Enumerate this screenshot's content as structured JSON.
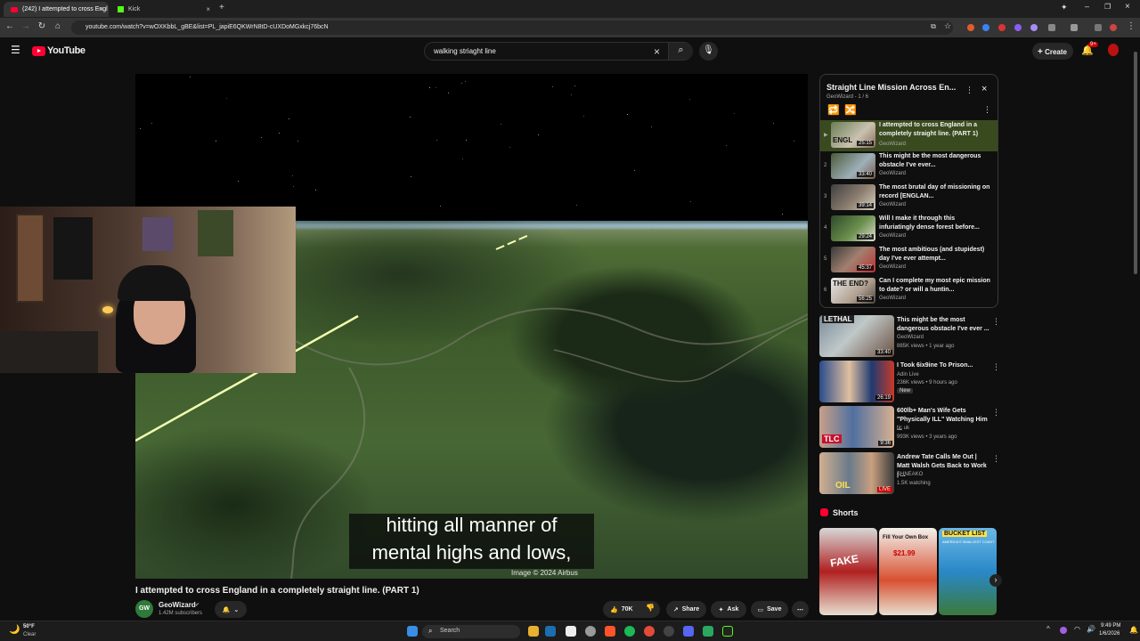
{
  "browser": {
    "tabs": [
      {
        "title": "(242) I attempted to cross Engl",
        "close": "×"
      },
      {
        "title": "Kick",
        "close": "×"
      }
    ],
    "new_tab": "+",
    "url": "youtube.com/watch?v=wOXKbbL_gBE&list=PL_japiE6QKWrN8tD-cUXDoMGxkcj76bcN"
  },
  "youtube": {
    "logo_text": "YouTube",
    "search_value": "walking striaght line",
    "create_label": "Create",
    "notif_badge": "9+"
  },
  "video": {
    "subtitle_line1": "hitting all manner of",
    "subtitle_line2": "mental highs and lows,",
    "credit": "Image © 2024 Airbus",
    "title": "I attempted to cross England in a completely straight line. (PART 1)",
    "channel": "GeoWizard",
    "channel_avatar": "GW",
    "subscribers": "1.42M subscribers",
    "likes": "70K",
    "share": "Share",
    "ask": "Ask",
    "save": "Save"
  },
  "playlist": {
    "title": "Straight Line Mission Across En...",
    "meta": "GeoWizard - 1 / 6",
    "items": [
      {
        "num": "▶",
        "title": "I attempted to cross England in a completely straight line. (PART 1)",
        "channel": "GeoWizard",
        "duration": "25:15",
        "thumb": "ENGL"
      },
      {
        "num": "2",
        "title": "This might be the most dangerous obstacle I've ever...",
        "channel": "GeoWizard",
        "duration": "33:40",
        "thumb": ""
      },
      {
        "num": "3",
        "title": "The most brutal day of missioning on record [ENGLAN...",
        "channel": "GeoWizard",
        "duration": "39:14",
        "thumb": ""
      },
      {
        "num": "4",
        "title": "Will I make it through this infuriatingly dense forest before...",
        "channel": "GeoWizard",
        "duration": "29:24",
        "thumb": ""
      },
      {
        "num": "5",
        "title": "The most ambitious (and stupidest) day I've ever attempt...",
        "channel": "GeoWizard",
        "duration": "45:37",
        "thumb": ""
      },
      {
        "num": "6",
        "title": "Can I complete my most epic mission to date? or will a huntin...",
        "channel": "GeoWizard",
        "duration": "56:25",
        "thumb": "THE END?"
      }
    ]
  },
  "recommendations": [
    {
      "title": "This might be the most dangerous obstacle I've ever ...",
      "channel": "GeoWizard",
      "meta": "885K views • 1 year ago",
      "duration": "33:40",
      "badge": "",
      "thumb_text": "LETHAL"
    },
    {
      "title": "I Took 6ix9ine To Prison...",
      "channel": "Adin Live",
      "meta": "236K views • 9 hours ago",
      "duration": "26:19",
      "badge": "New",
      "thumb_text": ""
    },
    {
      "title": "600lb+ Man's Wife Gets \"Physically ILL\" Watching Him ...",
      "channel": "tic uk",
      "meta": "993K views • 3 years ago",
      "duration": "9:36",
      "badge": "",
      "thumb_text": "TLC"
    },
    {
      "title": "Andrew Tate Calls Me Out | Matt Walsh Gets Back to Work | ...",
      "channel": "SHNEAKO",
      "meta": "1.5K watching",
      "duration": "LIVE",
      "badge": "",
      "thumb_text": "OIL"
    }
  ],
  "shorts": {
    "heading": "Shorts",
    "items": [
      {
        "text": "FAKE"
      },
      {
        "text": "Fill Your Own Box",
        "price": "$21.99"
      },
      {
        "text": "BUCKET LIST",
        "sub": "AMERICA'S SMALLEST COAST"
      }
    ]
  },
  "taskbar": {
    "weather_temp": "50°F",
    "weather_desc": "Clear",
    "search_label": "Search",
    "time": "9:49 PM",
    "date": "1/6/2026"
  }
}
